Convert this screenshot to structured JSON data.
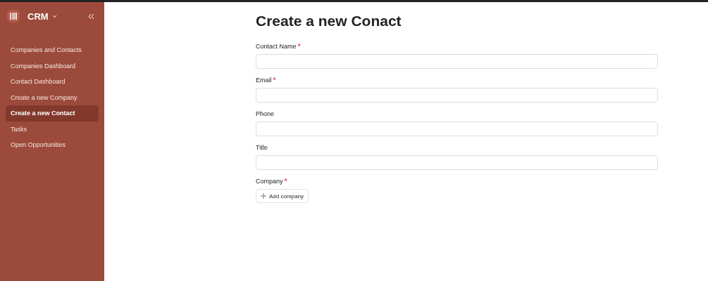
{
  "sidebar": {
    "app_name": "CRM",
    "items": [
      {
        "label": "Companies and Contacts",
        "selected": false
      },
      {
        "label": "Companies Dashboard",
        "selected": false
      },
      {
        "label": "Contact Dashboard",
        "selected": false
      },
      {
        "label": "Create a new Company",
        "selected": false
      },
      {
        "label": "Create a new Contact",
        "selected": true
      },
      {
        "label": "Tasks",
        "selected": false
      },
      {
        "label": "Open Opportunities",
        "selected": false
      }
    ]
  },
  "form": {
    "title": "Create a new Conact",
    "fields": [
      {
        "kind": "text",
        "label": "Contact Name",
        "required_mark": "*"
      },
      {
        "kind": "text",
        "label": "Email",
        "required_mark": "*"
      },
      {
        "kind": "text",
        "label": "Phone"
      },
      {
        "kind": "text",
        "label": "Title"
      },
      {
        "kind": "link",
        "label": "Company",
        "required_mark": "*",
        "button": "Add company"
      }
    ]
  }
}
